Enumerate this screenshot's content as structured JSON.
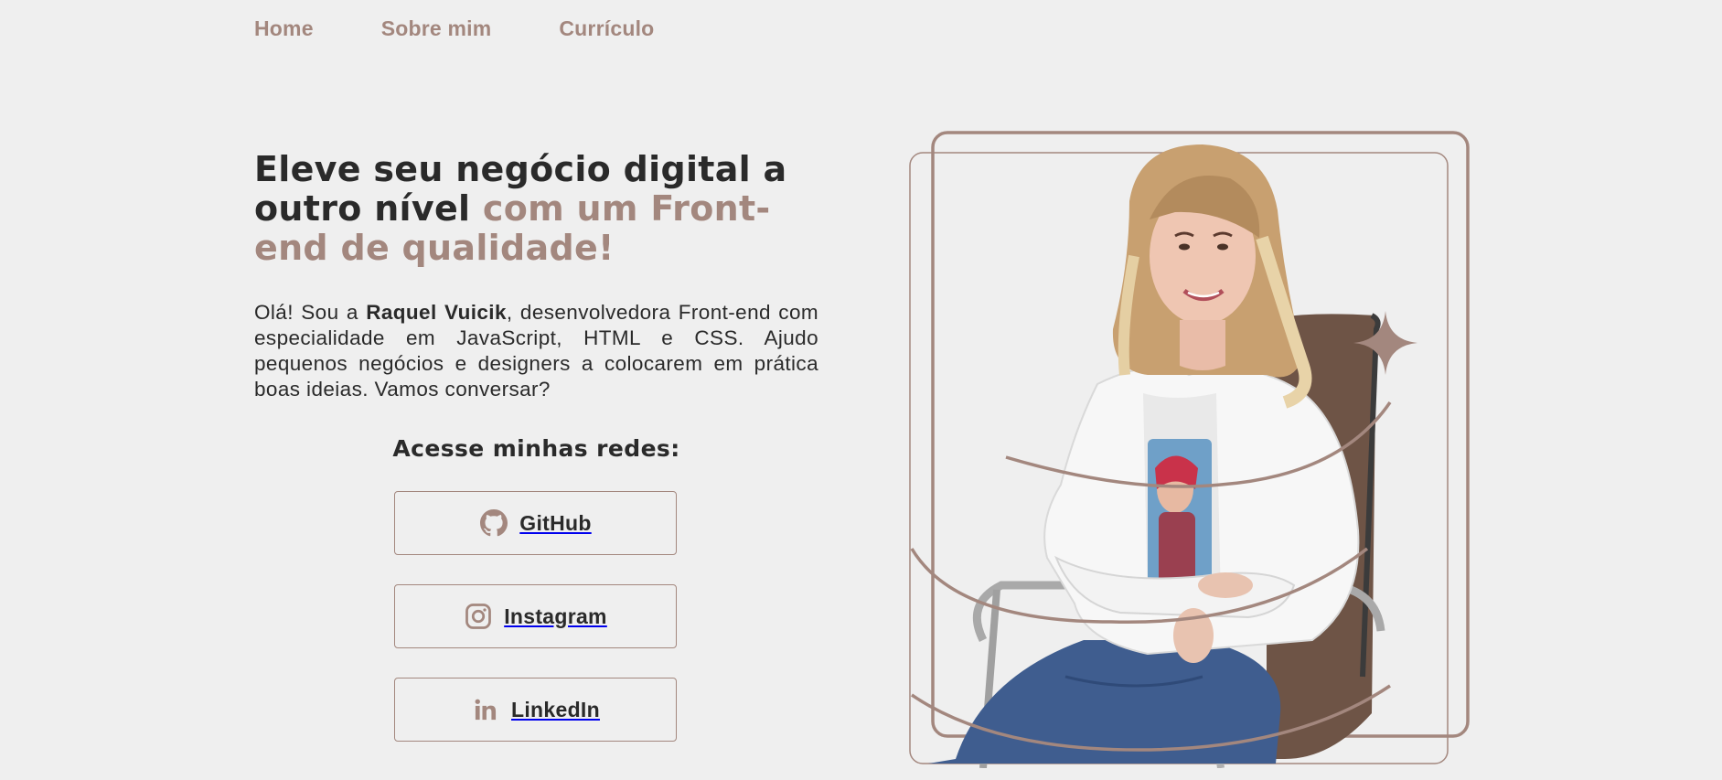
{
  "nav": {
    "items": [
      {
        "label": "Home"
      },
      {
        "label": "Sobre mim"
      },
      {
        "label": "Currículo"
      }
    ]
  },
  "hero": {
    "title_part1": "Eleve seu negócio digital a outro nível ",
    "title_accent": "com um Front-end de qualidade!",
    "intro_before": "Olá! Sou a ",
    "intro_name": "Raquel Vuicik",
    "intro_after": ", desenvolvedora Front-end com especialidade em JavaScript, HTML e CSS. Ajudo pequenos negócios e designers a colocarem em prática boas ideias. Vamos conversar?"
  },
  "networks": {
    "title": "Acesse minhas redes:",
    "buttons": [
      {
        "label": "GitHub",
        "icon": "github-icon"
      },
      {
        "label": "Instagram",
        "icon": "instagram-icon"
      },
      {
        "label": "LinkedIn",
        "icon": "linkedin-icon"
      }
    ]
  },
  "colors": {
    "accent": "#a3877e",
    "text": "#2a2a2a",
    "background": "#efefef"
  },
  "photo": {
    "subject": "profile-photo"
  }
}
